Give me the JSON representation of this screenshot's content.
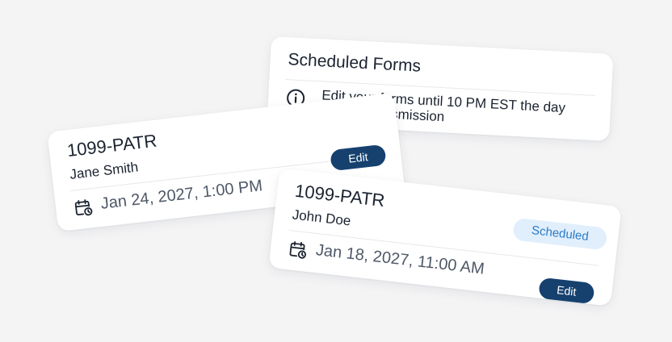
{
  "info_card": {
    "title": "Scheduled Forms",
    "icon": "info-circle-icon",
    "message": "Edit your forms until 10 PM EST the day before Transmission"
  },
  "forms": [
    {
      "code": "1099-PATR",
      "name": "Jane Smith",
      "date_icon": "calendar-clock-icon",
      "date": "Jan 24, 2027, 1:00 PM",
      "edit_label": "Edit"
    },
    {
      "code": "1099-PATR",
      "name": "John Doe",
      "status": "Scheduled",
      "date_icon": "calendar-clock-icon",
      "date": "Jan 18, 2027, 11:00 AM",
      "edit_label": "Edit"
    }
  ],
  "colors": {
    "background": "#f4f4f5",
    "primary_button": "#16416f",
    "status_badge_bg": "#e1effc",
    "status_badge_text": "#2a7ac9",
    "text": "#1b2330",
    "muted_text": "#4f5868"
  }
}
